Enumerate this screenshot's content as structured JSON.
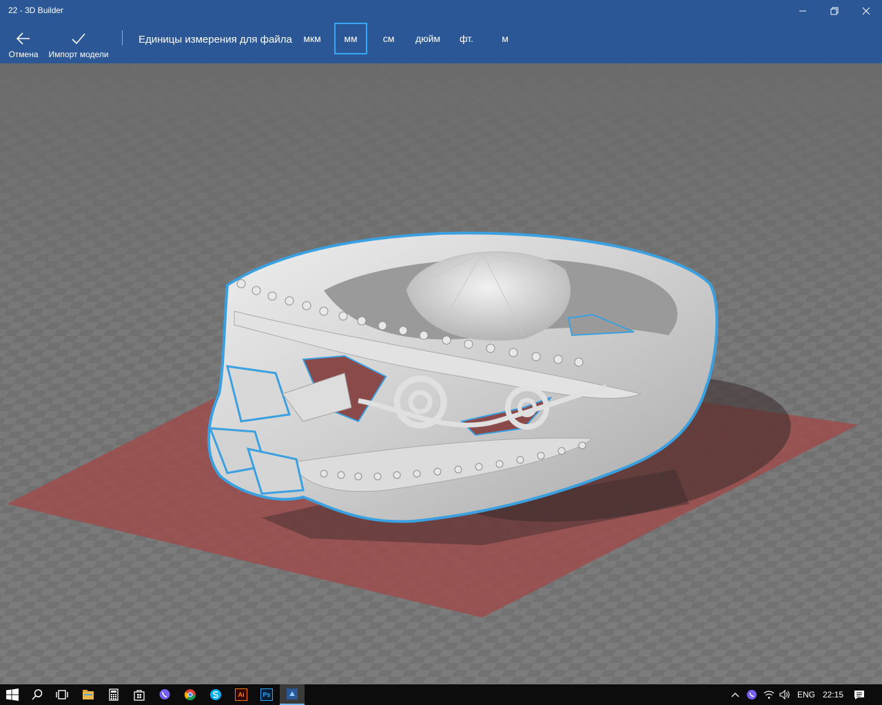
{
  "window": {
    "title": "22 - 3D Builder"
  },
  "commandbar": {
    "cancel_label": "Отмена",
    "import_label": "Импорт модели",
    "units_label": "Единицы измерения для файла",
    "units": [
      {
        "label": "мкм",
        "selected": false
      },
      {
        "label": "мм",
        "selected": true
      },
      {
        "label": "см",
        "selected": false
      },
      {
        "label": "дюйм",
        "selected": false
      },
      {
        "label": "фт.",
        "selected": false
      },
      {
        "label": "м",
        "selected": false
      }
    ]
  },
  "viewport": {
    "model": "ring",
    "colors": {
      "floor": "#7a7a7a",
      "build_plate": "#a04a4a",
      "model": "#d7d7d7",
      "selection": "#3aa0e0"
    }
  },
  "taskbar": {
    "icons": [
      "windows-start-icon",
      "search-icon",
      "task-view-icon",
      "file-explorer-icon",
      "calculator-icon",
      "store-icon",
      "viber-icon",
      "chrome-icon",
      "skype-icon",
      "illustrator-icon",
      "photoshop-icon",
      "3d-builder-icon"
    ],
    "illustrator_text": "Ai",
    "photoshop_text": "Ps",
    "language": "ENG",
    "time": "22:15"
  },
  "colors": {
    "accent": "#2b5797",
    "highlight": "#36a6f5",
    "taskbar": "#0c0c0c"
  }
}
